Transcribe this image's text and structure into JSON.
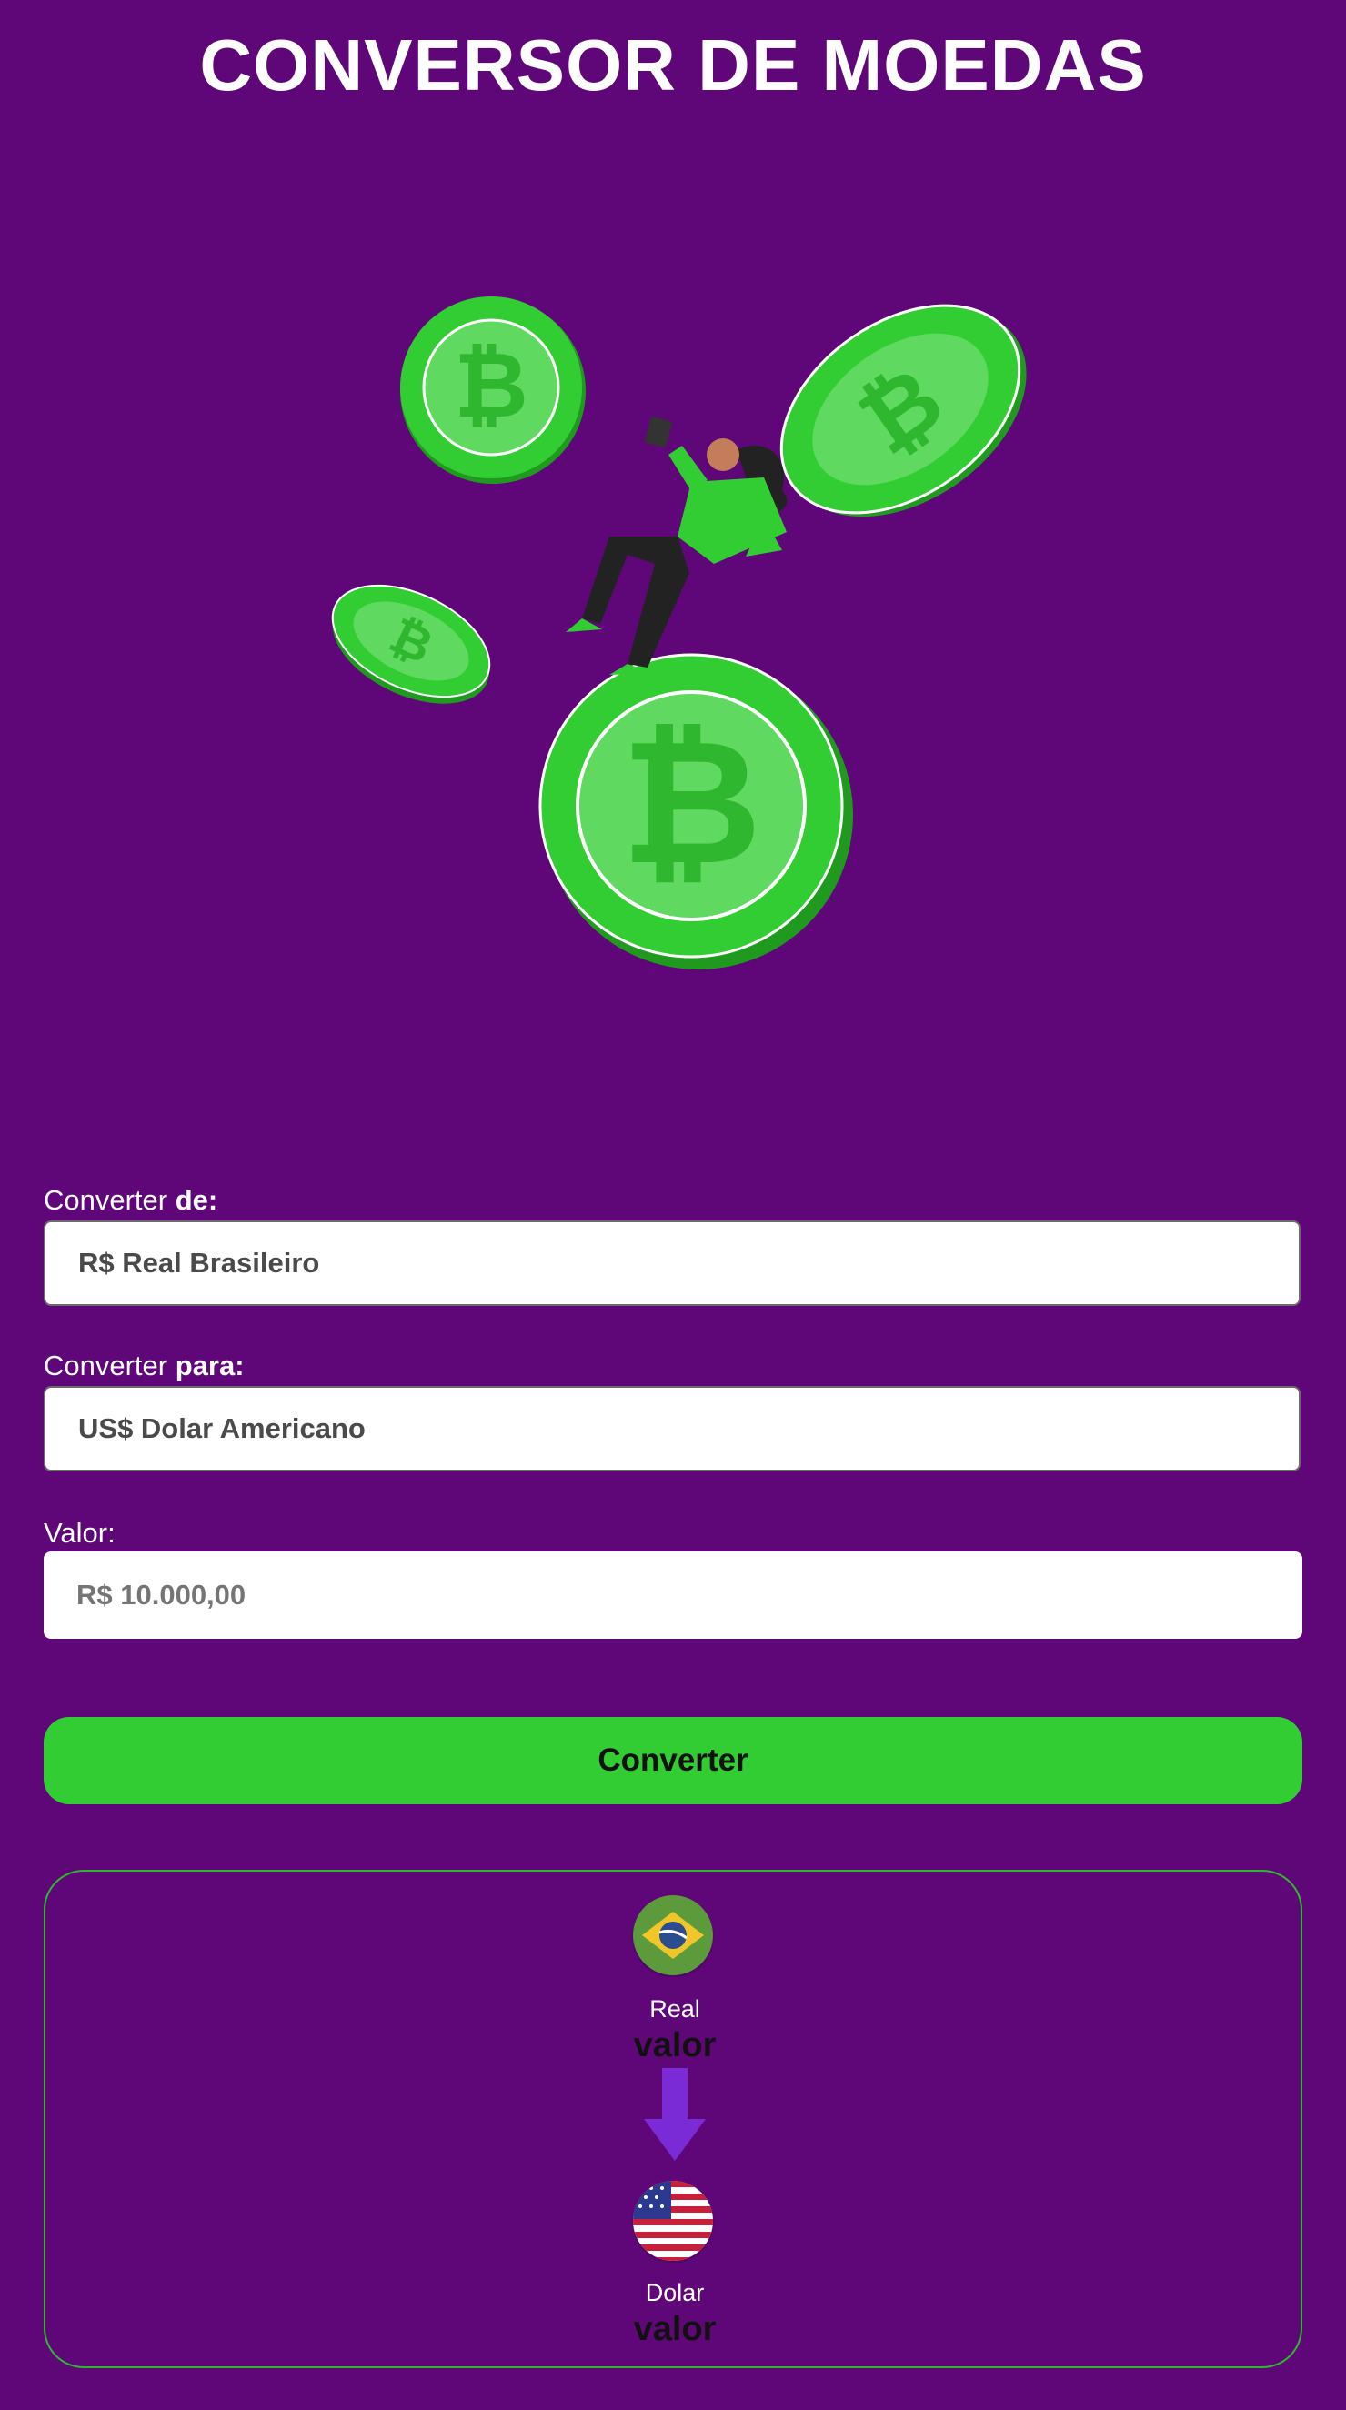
{
  "header": {
    "title": "CONVERSOR DE MOEDAS"
  },
  "form": {
    "from_label_prefix": "Converter",
    "from_label_bold": "de:",
    "from_selected": "R$ Real Brasileiro",
    "to_label_prefix": "Converter",
    "to_label_bold": "para:",
    "to_selected": "US$ Dolar Americano",
    "value_label": "Valor:",
    "value_placeholder": "R$ 10.000,00",
    "convert_label": "Converter"
  },
  "result": {
    "from_currency": "Real",
    "from_value": "valor",
    "to_currency": "Dolar",
    "to_value": "valor"
  },
  "colors": {
    "background": "#5f0778",
    "accent_green": "#32cd32",
    "arrow_purple": "#7a2bd6"
  },
  "icons": [
    "bitcoin-illustration",
    "brazil-flag-icon",
    "arrow-down-icon",
    "usa-flag-icon"
  ]
}
